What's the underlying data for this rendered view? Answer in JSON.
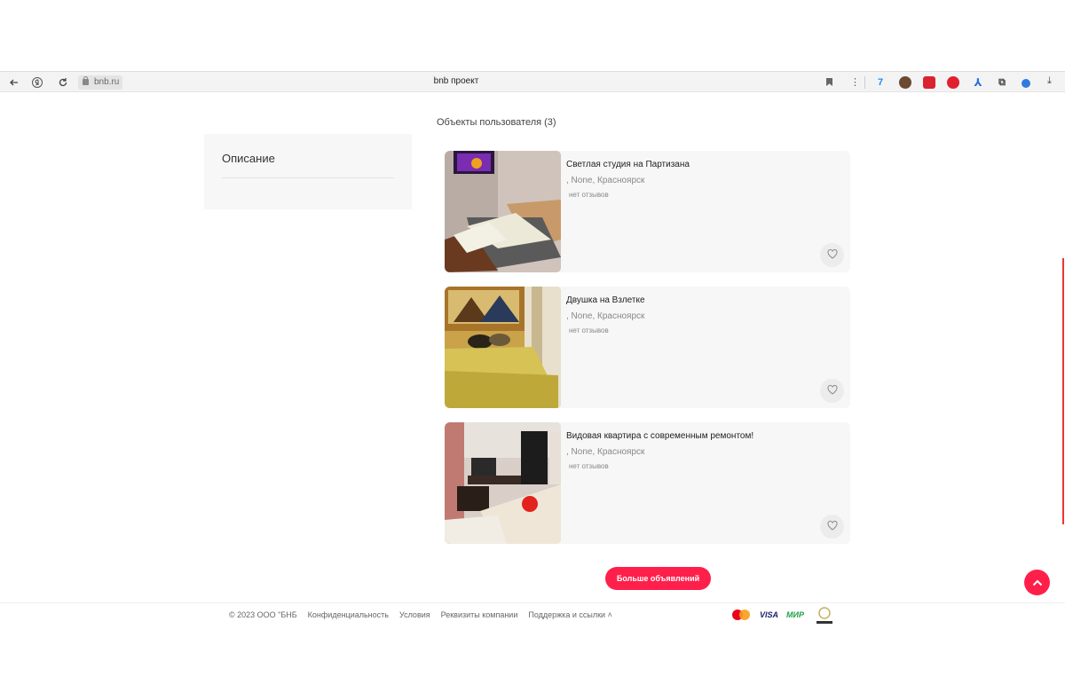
{
  "browser": {
    "url": "bnb.ru",
    "tab_title": "bnb проект"
  },
  "sidebar": {
    "title": "Описание"
  },
  "listings_section": {
    "heading": "Объекты пользователя (3)",
    "items": [
      {
        "title": "Светлая студия на Партизана",
        "location": ", None, Красноярск",
        "reviews": "нет отзывов"
      },
      {
        "title": "Двушка на Взлетке",
        "location": ", None, Красноярск",
        "reviews": "нет отзывов"
      },
      {
        "title": "Видовая квартира с современным ремонтом!",
        "location": ", None, Красноярск",
        "reviews": "нет отзывов"
      }
    ],
    "more_button": "Больше объявлений"
  },
  "footer": {
    "copyright": "© 2023 ООО \"БНБ",
    "links": [
      "Конфиденциальность",
      "Условия",
      "Реквизиты компании",
      "Поддержка и ссылки"
    ],
    "payment": {
      "visa": "VISA",
      "mir": "МИР",
      "tinkoff": "ТИНЬКОФФ"
    }
  },
  "colors": {
    "accent": "#ff1f4b",
    "card_bg": "#f7f7f7"
  },
  "icons": [
    "back-icon",
    "yandex-icon",
    "reload-icon",
    "lock-icon",
    "bookmark-icon",
    "menu-icon",
    "heart-icon",
    "chevron-up-icon",
    "download-icon"
  ]
}
